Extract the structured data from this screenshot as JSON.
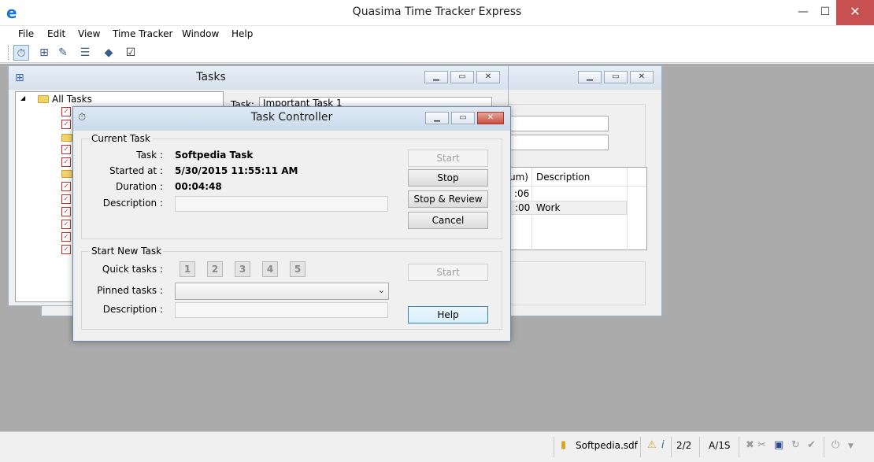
{
  "app": {
    "title": "Quasima Time Tracker Express",
    "icon": "ie-like-e-icon"
  },
  "window_buttons": {
    "minimize": "—",
    "maximize": "☐",
    "close": "✕"
  },
  "menu": [
    "File",
    "Edit",
    "View",
    "Time Tracker",
    "Window",
    "Help"
  ],
  "toolbar": [
    "task-controller-icon",
    "tasks-tree-icon",
    "edit-task-icon",
    "task-list-icon",
    "book-icon",
    "checkmark-icon"
  ],
  "tasks_window": {
    "title": "Tasks",
    "tree_root": "All Tasks",
    "task_label": "Task:",
    "task_value": "Important Task 1"
  },
  "back_window": {
    "column_duration_partial": "um)",
    "column_description": "Description",
    "rows": [
      {
        "duration": ":06",
        "description": ""
      },
      {
        "duration": ":00",
        "description": "Work"
      }
    ]
  },
  "task_controller": {
    "title": "Task Controller",
    "current_task": {
      "group_title": "Current Task",
      "task_label": "Task :",
      "task_value": "Softpedia Task",
      "started_label": "Started at :",
      "started_value": "5/30/2015 11:55:11 AM",
      "duration_label": "Duration :",
      "duration_value": "00:04:48",
      "description_label": "Description :",
      "description_value": ""
    },
    "buttons": {
      "start": "Start",
      "stop": "Stop",
      "stop_review": "Stop & Review",
      "cancel": "Cancel",
      "start_new": "Start",
      "help": "Help"
    },
    "start_new": {
      "group_title": "Start New Task",
      "quick_label": "Quick tasks :",
      "quick_tasks": [
        "1",
        "2",
        "3",
        "4",
        "5"
      ],
      "pinned_label": "Pinned tasks :",
      "pinned_value": "",
      "description_label": "Description :",
      "description_value": ""
    }
  },
  "statusbar": {
    "file": "Softpedia.sdf",
    "count": "2/2",
    "mode": "A/1S"
  }
}
